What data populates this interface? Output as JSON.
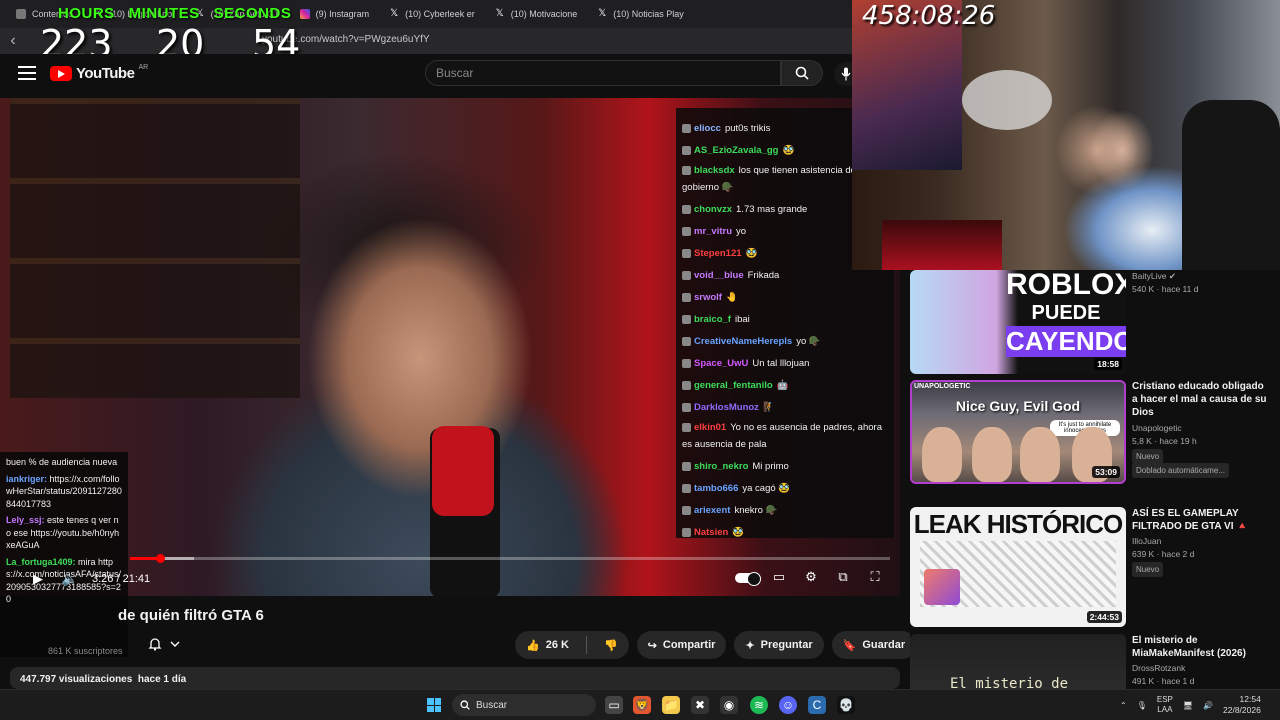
{
  "browser": {
    "tabs": [
      {
        "label": "Contenido",
        "icon": "gen"
      },
      {
        "label": "(10) Legión Loot",
        "icon": "x"
      },
      {
        "label": "(10) Zap Actu GT",
        "icon": "x"
      },
      {
        "label": "(9) Instagram",
        "icon": "ig"
      },
      {
        "label": "(10) Cyberleek er",
        "icon": "x"
      },
      {
        "label": "(10) Motivacione",
        "icon": "x"
      },
      {
        "label": "(10) Noticias Play",
        "icon": "x"
      }
    ],
    "url": "youtube.com/watch?v=PWgzeu6uYfY"
  },
  "overlay": {
    "labels": [
      "HOURS",
      "MINUTES",
      "SECONDS"
    ],
    "hours": "223",
    "minutes": "20",
    "seconds": "54",
    "countdown": "458:08:26"
  },
  "youtube": {
    "logo_text": "YouTube",
    "region": "AR",
    "search_placeholder": "Buscar"
  },
  "video": {
    "time_current": "3:26",
    "time_separator": "/",
    "time_total": "21:41",
    "progress_fraction": 0.04,
    "title": "de quién filtró GTA 6",
    "subscribers": "861 K suscriptores",
    "likes": "26 K",
    "share_label": "Compartir",
    "ask_label": "Preguntar",
    "save_label": "Guardar",
    "views": "447.797 visualizaciones",
    "age": "hace 1 día"
  },
  "chat_right": [
    {
      "user": "eliocc",
      "color": "#8ab4ff",
      "text": "put0s trikis"
    },
    {
      "user": "AS_EzioZavala_gg",
      "color": "#3ddc5a",
      "text": "🥸"
    },
    {
      "user": "blacksdx",
      "color": "#3ddc5a",
      "text": "los que tienen asistencia del gobierno 🪖",
      "wrap": true
    },
    {
      "user": "chonvzx",
      "color": "#3ddc5a",
      "text": "1.73 mas grande"
    },
    {
      "user": "mr_vitru",
      "color": "#c47aff",
      "text": "yo"
    },
    {
      "user": "Stepen121",
      "color": "#ff4040",
      "text": "🥸"
    },
    {
      "user": "void__blue",
      "color": "#c47aff",
      "text": "Frikada"
    },
    {
      "user": "srwolf",
      "color": "#c47aff",
      "text": "🤚"
    },
    {
      "user": "braico_f",
      "color": "#3ddc5a",
      "text": "ibai"
    },
    {
      "user": "CreativeNameHerepls",
      "color": "#6aa3ff",
      "text": "yo 🪖"
    },
    {
      "user": "Space_UwU",
      "color": "#d45aff",
      "text": "Un tal lllojuan"
    },
    {
      "user": "general_fentanilo",
      "color": "#3ddc5a",
      "text": "🤖"
    },
    {
      "user": "DarklosMunoz",
      "color": "#8f6cff",
      "text": "🧗"
    },
    {
      "user": "elkin01",
      "color": "#ff4040",
      "text": "Yo no es ausencia de padres, ahora es ausencia de pala",
      "wrap": true
    },
    {
      "user": "shiro_nekro",
      "color": "#3ddc5a",
      "text": "Mi primo"
    },
    {
      "user": "tambo666",
      "color": "#6aa3ff",
      "text": "ya cagó 🥸"
    },
    {
      "user": "ariexent",
      "color": "#6aa3ff",
      "text": "knekro 🪖"
    },
    {
      "user": "Natsien",
      "color": "#ff4040",
      "text": "🥸"
    }
  ],
  "chat_left": [
    {
      "user": "",
      "color": "#eee",
      "text": "buen % de audiencia nueva"
    },
    {
      "user": "iankriger:",
      "color": "#6aa3ff",
      "text": "https://x.com/followHerStar/status/2091127280844017783"
    },
    {
      "user": "Lely_ssj:",
      "color": "#c47aff",
      "text": "este tenes q ver no ese https://youtu.be/h0nyhxeAGuA"
    },
    {
      "user": "La_fortuga1409:",
      "color": "#3ddc5a",
      "text": "mira https://x.com/noticiasAFA/status/2090530327773188585?s=20"
    }
  ],
  "recommendations": [
    {
      "title": "",
      "channel": "BaityLive",
      "meta": "540 K · hace 11 d",
      "duration": "18:58",
      "thumb_lines": [
        "ROBLOX",
        "PUEDE ESTAR",
        "CAYENDO"
      ]
    },
    {
      "title": "Cristiano educado obligado a hacer el mal a causa de su Dios",
      "channel": "Unapologetic",
      "meta": "5,8 K · hace 19 h",
      "badges": [
        "Nuevo",
        "Doblado automáticame..."
      ],
      "duration": "53:09",
      "thumb_brand": "UNAPOLOGETIC",
      "thumb_head": "Nice Guy, Evil God",
      "thumb_note": "It's just to annihilate innocent babies"
    },
    {
      "title": "ASÍ ES EL GAMEPLAY FILTRADO DE GTA VI 🔺",
      "channel": "IlloJuan",
      "meta": "639 K · hace 2 d",
      "badges": [
        "Nuevo"
      ],
      "duration": "2:44:53",
      "thumb_head": "LEAK HISTÓRICO"
    },
    {
      "title": "El misterio de MiaMakeManifest (2026)",
      "channel": "DrossRotzank",
      "meta": "491 K · hace 1 d",
      "thumb_text": "El misterio de"
    }
  ],
  "taskbar": {
    "search": "Buscar",
    "lang_top": "ESP",
    "lang_bottom": "LAA",
    "time": "12:54",
    "date": "22/8/2026"
  }
}
